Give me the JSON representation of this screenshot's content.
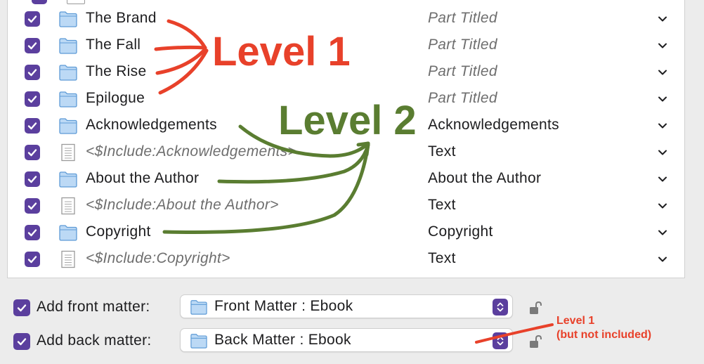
{
  "rows": [
    {
      "title": "The Brand",
      "type": "Part Titled",
      "icon": "folder-icon",
      "title_placeholder": false,
      "type_muted": true
    },
    {
      "title": "The Fall",
      "type": "Part Titled",
      "icon": "folder-icon",
      "title_placeholder": false,
      "type_muted": true
    },
    {
      "title": "The Rise",
      "type": "Part Titled",
      "icon": "folder-icon",
      "title_placeholder": false,
      "type_muted": true
    },
    {
      "title": "Epilogue",
      "type": "Part Titled",
      "icon": "folder-icon",
      "title_placeholder": false,
      "type_muted": true
    },
    {
      "title": "Acknowledgements",
      "type": "Acknowledgements",
      "icon": "folder-icon",
      "title_placeholder": false,
      "type_muted": false
    },
    {
      "title": "<$Include:Acknowledgements>",
      "type": "Text",
      "icon": "document-icon",
      "title_placeholder": true,
      "type_muted": false
    },
    {
      "title": "About the Author",
      "type": "About the Author",
      "icon": "folder-icon",
      "title_placeholder": false,
      "type_muted": false
    },
    {
      "title": "<$Include:About the Author>",
      "type": "Text",
      "icon": "document-icon",
      "title_placeholder": true,
      "type_muted": false
    },
    {
      "title": "Copyright",
      "type": "Copyright",
      "icon": "folder-icon",
      "title_placeholder": false,
      "type_muted": false
    },
    {
      "title": "<$Include:Copyright>",
      "type": "Text",
      "icon": "document-icon",
      "title_placeholder": true,
      "type_muted": false
    }
  ],
  "front_matter": {
    "label": "Add front matter:",
    "value": "Front Matter : Ebook",
    "checked": true
  },
  "back_matter": {
    "label": "Add back matter:",
    "value": "Back Matter : Ebook",
    "checked": true
  },
  "annotations": {
    "level1": "Level 1",
    "level2": "Level 2",
    "small_line1": "Level 1",
    "small_line2": "(but not included)"
  },
  "colors": {
    "checkbox": "#5b3f9e",
    "folder_fill": "#bcd9f5",
    "folder_stroke": "#5e9bd6",
    "annotation_red": "#e8412a",
    "annotation_green": "#5a7d31"
  }
}
